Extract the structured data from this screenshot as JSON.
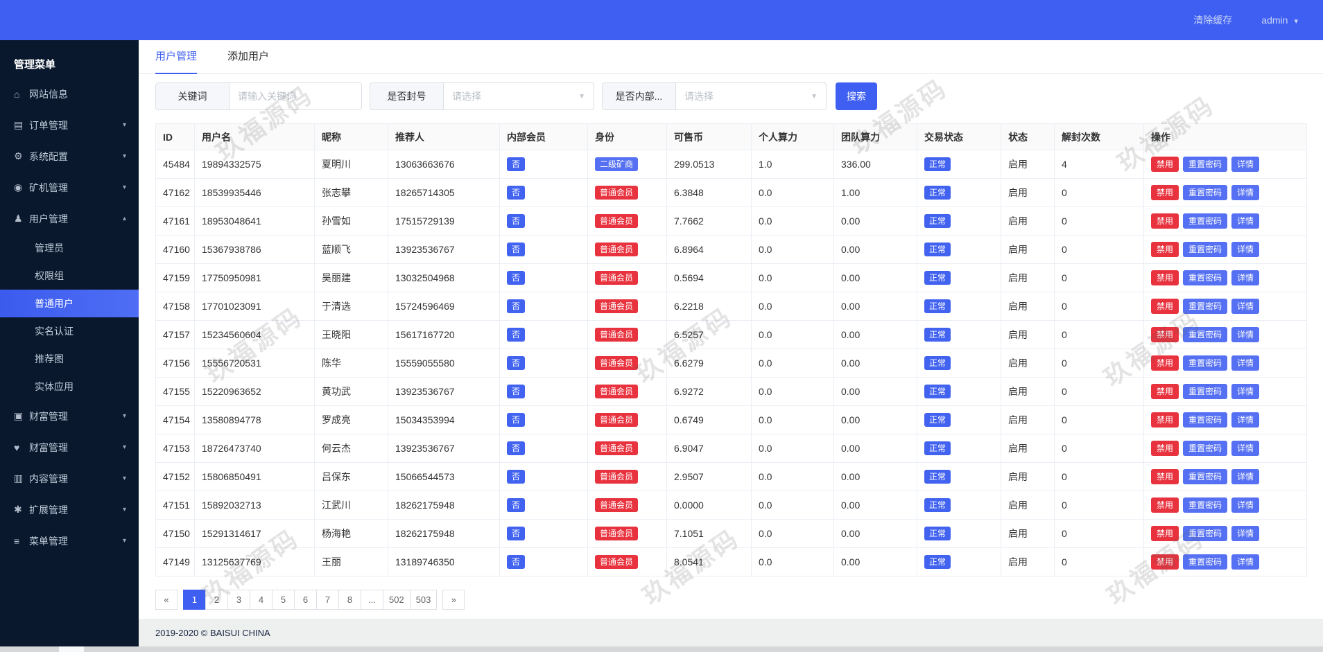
{
  "colors": {
    "primary": "#3e5ff1",
    "sidebar_bg": "#0a182e",
    "badge_red": "#e8333f",
    "badge_blue": "#4263f0",
    "badge_light_blue": "#5570f2"
  },
  "topbar": {
    "clear_cache": "清除缓存",
    "username": "admin"
  },
  "sidebar": {
    "title": "管理菜单",
    "items": [
      {
        "label": "网站信息",
        "icon": "home-icon",
        "glyph": "⌂",
        "arrow": ""
      },
      {
        "label": "订单管理",
        "icon": "orders-icon",
        "glyph": "▤",
        "arrow": "▾"
      },
      {
        "label": "系统配置",
        "icon": "gears-icon",
        "glyph": "⚙",
        "arrow": "▾"
      },
      {
        "label": "矿机管理",
        "icon": "miner-icon",
        "glyph": "◉",
        "arrow": "▾"
      },
      {
        "label": "用户管理",
        "icon": "users-icon",
        "glyph": "♟",
        "arrow": "▴",
        "children": [
          {
            "label": "管理员",
            "active": false
          },
          {
            "label": "权限组",
            "active": false
          },
          {
            "label": "普通用户",
            "active": true
          },
          {
            "label": "实名认证",
            "active": false
          },
          {
            "label": "推荐图",
            "active": false
          },
          {
            "label": "实体应用",
            "active": false
          }
        ]
      },
      {
        "label": "财富管理",
        "icon": "money-icon",
        "glyph": "▣",
        "arrow": "▾"
      },
      {
        "label": "财富管理",
        "icon": "health-icon",
        "glyph": "♥",
        "arrow": "▾"
      },
      {
        "label": "内容管理",
        "icon": "content-icon",
        "glyph": "▥",
        "arrow": "▾"
      },
      {
        "label": "扩展管理",
        "icon": "wrench-icon",
        "glyph": "✱",
        "arrow": "▾"
      },
      {
        "label": "菜单管理",
        "icon": "menu-icon",
        "glyph": "≡",
        "arrow": "▾"
      }
    ]
  },
  "tabs": [
    {
      "label": "用户管理",
      "active": true
    },
    {
      "label": "添加用户",
      "active": false
    }
  ],
  "filters": {
    "keyword_label": "关键词",
    "keyword_placeholder": "请输入关键词",
    "ban_label": "是否封号",
    "ban_placeholder": "请选择",
    "internal_label": "是否内部...",
    "internal_placeholder": "请选择",
    "search_label": "搜索"
  },
  "table": {
    "columns": [
      "ID",
      "用户名",
      "昵称",
      "推荐人",
      "内部会员",
      "身份",
      "可售币",
      "个人算力",
      "团队算力",
      "交易状态",
      "状态",
      "解封次数",
      "操作"
    ],
    "internal_badge": "否",
    "trade_status_badge": "正常",
    "action_labels": [
      "禁用",
      "重置密码",
      "详情"
    ],
    "rows": [
      {
        "id": "45484",
        "username": "19894332575",
        "nickname": "夏明川",
        "referrer": "13063663676",
        "internal": "否",
        "identity": "二级矿商",
        "identity_color": "blue",
        "coins": "299.0513",
        "personal_power": "1.0",
        "team_power": "336.00",
        "trade_status": "正常",
        "status": "启用",
        "unban_count": "4"
      },
      {
        "id": "47162",
        "username": "18539935446",
        "nickname": "张志攀",
        "referrer": "18265714305",
        "internal": "否",
        "identity": "普通会员",
        "identity_color": "red",
        "coins": "6.3848",
        "personal_power": "0.0",
        "team_power": "1.00",
        "trade_status": "正常",
        "status": "启用",
        "unban_count": "0"
      },
      {
        "id": "47161",
        "username": "18953048641",
        "nickname": "孙雪如",
        "referrer": "17515729139",
        "internal": "否",
        "identity": "普通会员",
        "identity_color": "red",
        "coins": "7.7662",
        "personal_power": "0.0",
        "team_power": "0.00",
        "trade_status": "正常",
        "status": "启用",
        "unban_count": "0"
      },
      {
        "id": "47160",
        "username": "15367938786",
        "nickname": "蓝顺飞",
        "referrer": "13923536767",
        "internal": "否",
        "identity": "普通会员",
        "identity_color": "red",
        "coins": "6.8964",
        "personal_power": "0.0",
        "team_power": "0.00",
        "trade_status": "正常",
        "status": "启用",
        "unban_count": "0"
      },
      {
        "id": "47159",
        "username": "17750950981",
        "nickname": "吴丽建",
        "referrer": "13032504968",
        "internal": "否",
        "identity": "普通会员",
        "identity_color": "red",
        "coins": "0.5694",
        "personal_power": "0.0",
        "team_power": "0.00",
        "trade_status": "正常",
        "status": "启用",
        "unban_count": "0"
      },
      {
        "id": "47158",
        "username": "17701023091",
        "nickname": "于清选",
        "referrer": "15724596469",
        "internal": "否",
        "identity": "普通会员",
        "identity_color": "red",
        "coins": "6.2218",
        "personal_power": "0.0",
        "team_power": "0.00",
        "trade_status": "正常",
        "status": "启用",
        "unban_count": "0"
      },
      {
        "id": "47157",
        "username": "15234560604",
        "nickname": "王晓阳",
        "referrer": "15617167720",
        "internal": "否",
        "identity": "普通会员",
        "identity_color": "red",
        "coins": "6.5257",
        "personal_power": "0.0",
        "team_power": "0.00",
        "trade_status": "正常",
        "status": "启用",
        "unban_count": "0"
      },
      {
        "id": "47156",
        "username": "15556720531",
        "nickname": "陈华",
        "referrer": "15559055580",
        "internal": "否",
        "identity": "普通会员",
        "identity_color": "red",
        "coins": "6.6279",
        "personal_power": "0.0",
        "team_power": "0.00",
        "trade_status": "正常",
        "status": "启用",
        "unban_count": "0"
      },
      {
        "id": "47155",
        "username": "15220963652",
        "nickname": "黄功武",
        "referrer": "13923536767",
        "internal": "否",
        "identity": "普通会员",
        "identity_color": "red",
        "coins": "6.9272",
        "personal_power": "0.0",
        "team_power": "0.00",
        "trade_status": "正常",
        "status": "启用",
        "unban_count": "0"
      },
      {
        "id": "47154",
        "username": "13580894778",
        "nickname": "罗成亮",
        "referrer": "15034353994",
        "internal": "否",
        "identity": "普通会员",
        "identity_color": "red",
        "coins": "0.6749",
        "personal_power": "0.0",
        "team_power": "0.00",
        "trade_status": "正常",
        "status": "启用",
        "unban_count": "0"
      },
      {
        "id": "47153",
        "username": "18726473740",
        "nickname": "何云杰",
        "referrer": "13923536767",
        "internal": "否",
        "identity": "普通会员",
        "identity_color": "red",
        "coins": "6.9047",
        "personal_power": "0.0",
        "team_power": "0.00",
        "trade_status": "正常",
        "status": "启用",
        "unban_count": "0"
      },
      {
        "id": "47152",
        "username": "15806850491",
        "nickname": "吕保东",
        "referrer": "15066544573",
        "internal": "否",
        "identity": "普通会员",
        "identity_color": "red",
        "coins": "2.9507",
        "personal_power": "0.0",
        "team_power": "0.00",
        "trade_status": "正常",
        "status": "启用",
        "unban_count": "0"
      },
      {
        "id": "47151",
        "username": "15892032713",
        "nickname": "江武川",
        "referrer": "18262175948",
        "internal": "否",
        "identity": "普通会员",
        "identity_color": "red",
        "coins": "0.0000",
        "personal_power": "0.0",
        "team_power": "0.00",
        "trade_status": "正常",
        "status": "启用",
        "unban_count": "0"
      },
      {
        "id": "47150",
        "username": "15291314617",
        "nickname": "杨海艳",
        "referrer": "18262175948",
        "internal": "否",
        "identity": "普通会员",
        "identity_color": "red",
        "coins": "7.1051",
        "personal_power": "0.0",
        "team_power": "0.00",
        "trade_status": "正常",
        "status": "启用",
        "unban_count": "0"
      },
      {
        "id": "47149",
        "username": "13125637769",
        "nickname": "王丽",
        "referrer": "13189746350",
        "internal": "否",
        "identity": "普通会员",
        "identity_color": "red",
        "coins": "8.0541",
        "personal_power": "0.0",
        "team_power": "0.00",
        "trade_status": "正常",
        "status": "启用",
        "unban_count": "0"
      }
    ]
  },
  "pagination": {
    "prev": "«",
    "next": "»",
    "pages": [
      "1",
      "2",
      "3",
      "4",
      "5",
      "6",
      "7",
      "8",
      "...",
      "502",
      "503"
    ],
    "active": "1"
  },
  "footer": {
    "copyright": "2019-2020 © BAISUI CHINA"
  },
  "watermark": {
    "text": "玖福源码"
  }
}
